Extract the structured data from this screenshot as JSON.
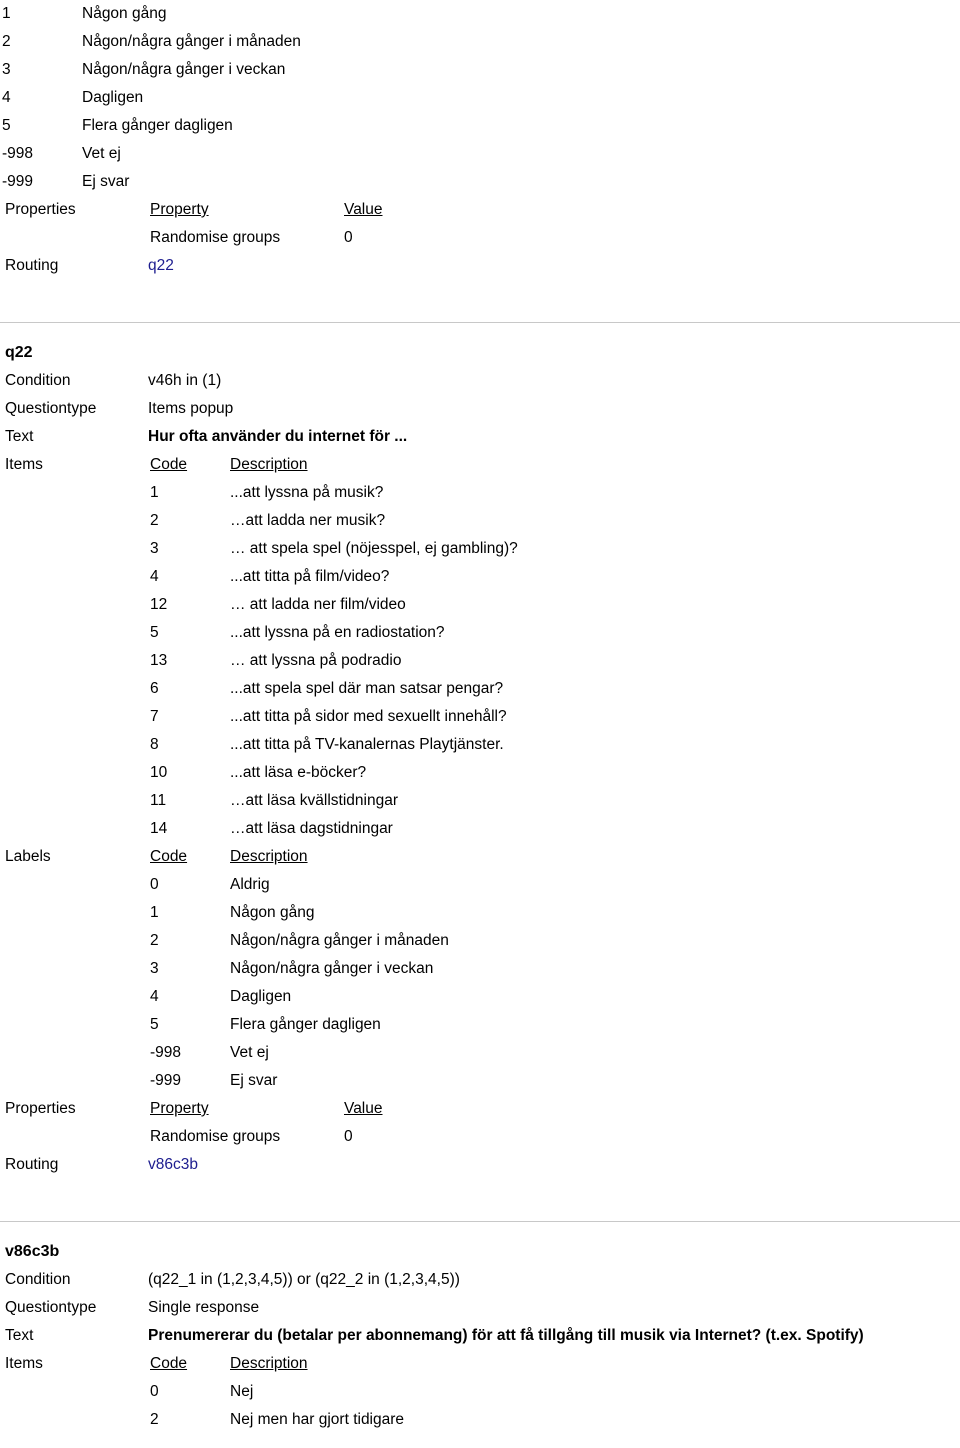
{
  "theme": {
    "link_color": "#1d1d8f",
    "divider_color": "#c8c8c8",
    "text_color": "#000000",
    "background": "#ffffff"
  },
  "field_labels": {
    "condition": "Condition",
    "questiontype": "Questiontype",
    "text": "Text",
    "items": "Items",
    "labels": "Labels",
    "properties": "Properties",
    "routing": "Routing"
  },
  "table_headers": {
    "code": "Code",
    "description": "Description",
    "property": "Property",
    "value": "Value"
  },
  "continued_labels": {
    "rows": [
      {
        "code": "1",
        "description": "Någon gång"
      },
      {
        "code": "2",
        "description": "Någon/några gånger i månaden"
      },
      {
        "code": "3",
        "description": "Någon/några gånger i veckan"
      },
      {
        "code": "4",
        "description": "Dagligen"
      },
      {
        "code": "5",
        "description": "Flera gånger dagligen"
      },
      {
        "code": "-998",
        "description": "Vet ej"
      },
      {
        "code": "-999",
        "description": "Ej svar"
      }
    ]
  },
  "continued_properties": {
    "rows": [
      {
        "property": "Randomise groups",
        "value": "0"
      }
    ]
  },
  "continued_routing": {
    "target": "q22"
  },
  "questions": [
    {
      "id": "q22",
      "condition": "v46h in (1)",
      "questiontype": "Items popup",
      "text": "Hur ofta använder du internet för ...",
      "items": [
        {
          "code": "1",
          "description": "...att lyssna på musik?"
        },
        {
          "code": "2",
          "description": "…att ladda ner musik?"
        },
        {
          "code": "3",
          "description": "… att spela spel (nöjesspel, ej gambling)?"
        },
        {
          "code": "4",
          "description": "...att titta på film/video?"
        },
        {
          "code": "12",
          "description": "… att ladda ner film/video"
        },
        {
          "code": "5",
          "description": "...att lyssna på en radiostation?"
        },
        {
          "code": "13",
          "description": "… att lyssna på podradio"
        },
        {
          "code": "6",
          "description": "...att spela spel där man satsar pengar?"
        },
        {
          "code": "7",
          "description": "...att titta på sidor med sexuellt innehåll?"
        },
        {
          "code": "8",
          "description": "...att titta på TV-kanalernas Playtjänster."
        },
        {
          "code": "10",
          "description": "...att läsa e-böcker?"
        },
        {
          "code": "11",
          "description": "…att läsa kvällstidningar"
        },
        {
          "code": "14",
          "description": "…att läsa dagstidningar"
        }
      ],
      "labels": [
        {
          "code": "0",
          "description": "Aldrig"
        },
        {
          "code": "1",
          "description": "Någon gång"
        },
        {
          "code": "2",
          "description": "Någon/några gånger i månaden"
        },
        {
          "code": "3",
          "description": "Någon/några gånger i veckan"
        },
        {
          "code": "4",
          "description": "Dagligen"
        },
        {
          "code": "5",
          "description": "Flera gånger dagligen"
        },
        {
          "code": "-998",
          "description": "Vet ej"
        },
        {
          "code": "-999",
          "description": "Ej svar"
        }
      ],
      "properties": [
        {
          "property": "Randomise groups",
          "value": "0"
        }
      ],
      "routing": "v86c3b"
    },
    {
      "id": "v86c3b",
      "condition": "(q22_1 in (1,2,3,4,5)) or (q22_2 in (1,2,3,4,5))",
      "questiontype": "Single response",
      "text": "Prenumererar du (betalar per abonnemang) för att få tillgång till musik via Internet? (t.ex. Spotify)",
      "items": [
        {
          "code": "0",
          "description": "Nej"
        },
        {
          "code": "2",
          "description": "Nej men har gjort tidigare"
        }
      ]
    }
  ]
}
